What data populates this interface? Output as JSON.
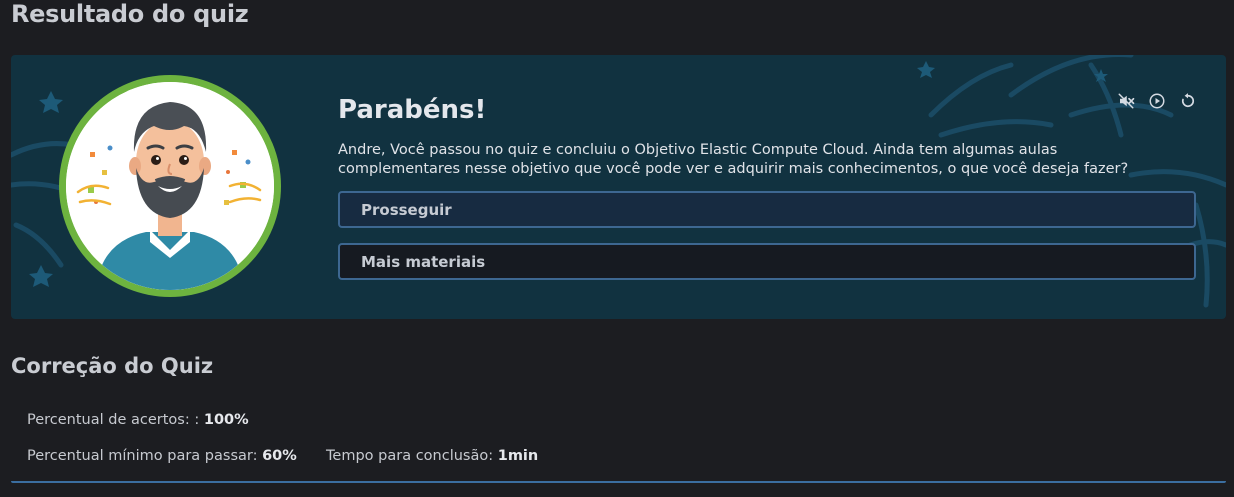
{
  "page": {
    "title": "Resultado do quiz"
  },
  "banner": {
    "heading": "Parabéns!",
    "message": "Andre, Você passou no quiz e concluiu o Objetivo Elastic Compute Cloud. Ainda tem algumas aulas complementares nesse objetivo que você pode ver e adquirir mais conhecimentos, o que você deseja fazer?",
    "buttons": {
      "continue_label": "Prosseguir",
      "more_label": "Mais materiais"
    },
    "controls": {
      "mute_icon": "volume-off-icon",
      "play_icon": "play-circle-icon",
      "replay_icon": "replay-icon"
    },
    "colors": {
      "banner_bg": "#113240",
      "avatar_ring": "#6db33f",
      "button_border": "#3d6791"
    }
  },
  "correction": {
    "title": "Correção do Quiz",
    "accuracy_label": "Percentual de acertos: :",
    "accuracy_value": "100%",
    "min_pass_label": "Percentual mínimo para passar:",
    "min_pass_value": "60%",
    "time_label": "Tempo para conclusão:",
    "time_value": "1min"
  }
}
